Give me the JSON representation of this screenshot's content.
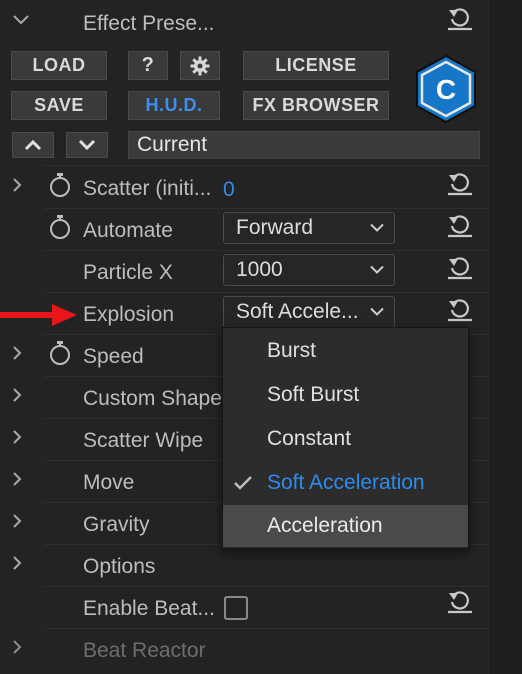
{
  "header": {
    "title": "Effect Prese..."
  },
  "buttons": {
    "load": "LOAD",
    "help": "?",
    "license": "LICENSE",
    "save": "SAVE",
    "hud": "H.U.D.",
    "fx_browser": "FX BROWSER"
  },
  "preset_field": {
    "value": "Current"
  },
  "logo": {
    "letter": "C"
  },
  "properties": [
    {
      "label": "Scatter (initi...",
      "value": "0"
    },
    {
      "label": "Automate",
      "value": "Forward"
    },
    {
      "label": "Particle X",
      "value": "1000"
    },
    {
      "label": "Explosion",
      "value": "Soft Accele..."
    },
    {
      "label": "Speed"
    },
    {
      "label": "Custom Shape"
    },
    {
      "label": "Scatter Wipe"
    },
    {
      "label": "Move"
    },
    {
      "label": "Gravity"
    },
    {
      "label": "Options"
    },
    {
      "label": "Enable Beat..."
    },
    {
      "label": "Beat Reactor"
    }
  ],
  "dropdown": {
    "options": [
      "Burst",
      "Soft Burst",
      "Constant",
      "Soft Acceleration",
      "Acceleration"
    ],
    "selected": "Soft Acceleration",
    "hovered": "Acceleration"
  },
  "colors": {
    "accent_blue": "#2d8ceb",
    "arrow_red": "#e8151b",
    "background": "#232323"
  },
  "icons": [
    "chevron-right-icon",
    "chevron-down-icon",
    "stopwatch-icon",
    "reset-icon",
    "gear-icon",
    "checkmark-icon",
    "red-arrow-icon"
  ]
}
